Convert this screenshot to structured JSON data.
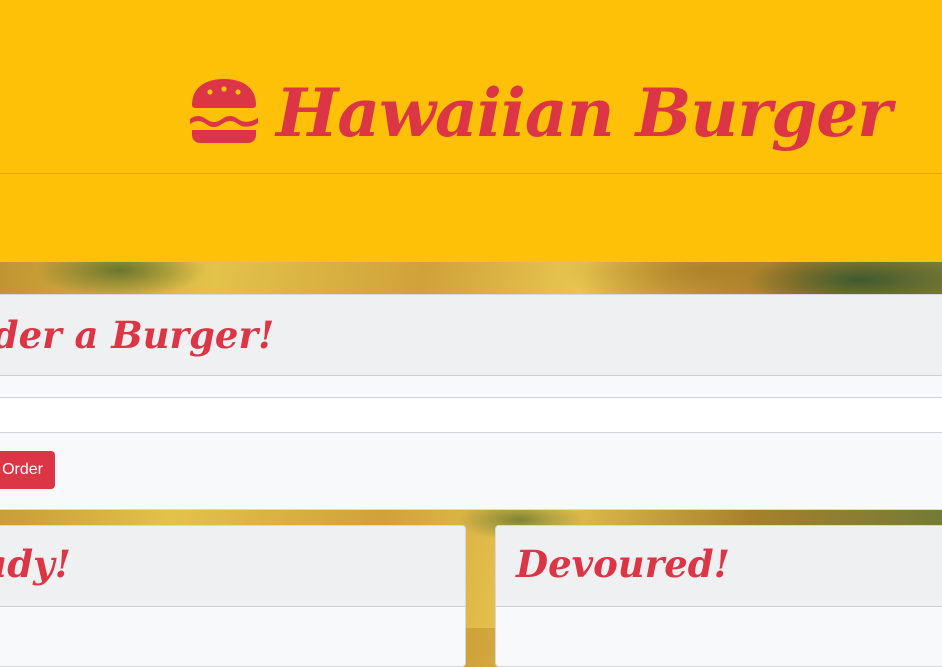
{
  "header": {
    "icon": "hamburger-icon",
    "title": "Hawaiian Burger"
  },
  "order_form": {
    "title": "Order a Burger!",
    "input_value": "",
    "button_label": "Order"
  },
  "ready_card": {
    "title": "Ready!"
  },
  "devoured_card": {
    "title": "Devoured!"
  },
  "colors": {
    "brand_yellow": "#ffc107",
    "brand_red": "#dc3545",
    "card_bg": "#f8f9fa"
  }
}
